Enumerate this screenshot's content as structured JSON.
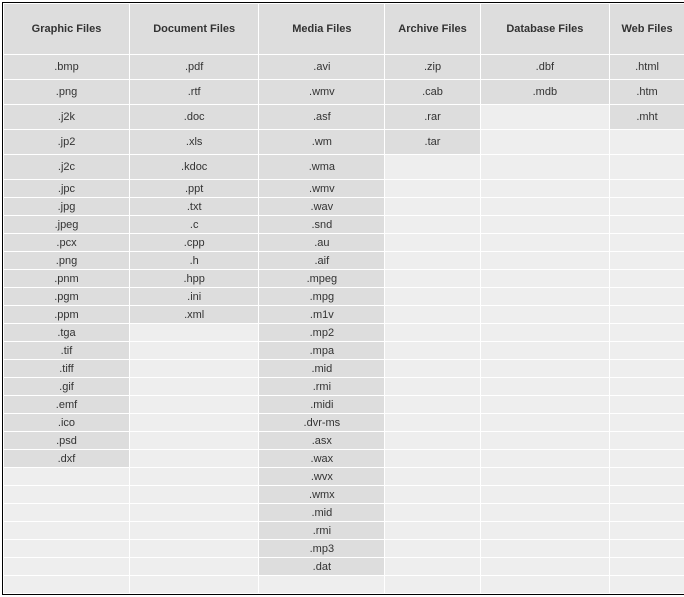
{
  "headers": [
    "Graphic Files",
    "Document Files",
    "Media Files",
    "Archive Files",
    "Database Files",
    "Web Files"
  ],
  "tallRows": 5,
  "columns": [
    [
      ".bmp",
      ".png",
      ".j2k",
      ".jp2",
      ".j2c",
      ".jpc",
      ".jpg",
      ".jpeg",
      ".pcx",
      ".png",
      ".pnm",
      ".pgm",
      ".ppm",
      ".tga",
      ".tif",
      ".tiff",
      ".gif",
      ".emf",
      ".ico",
      ".psd",
      ".dxf",
      "",
      "",
      "",
      "",
      "",
      "",
      ""
    ],
    [
      ".pdf",
      ".rtf",
      ".doc",
      ".xls",
      ".kdoc",
      ".ppt",
      ".txt",
      ".c",
      ".cpp",
      ".h",
      ".hpp",
      ".ini",
      ".xml",
      "",
      "",
      "",
      "",
      "",
      "",
      "",
      "",
      "",
      "",
      "",
      "",
      "",
      "",
      ""
    ],
    [
      ".avi",
      ".wmv",
      ".asf",
      ".wm",
      ".wma",
      ".wmv",
      ".wav",
      ".snd",
      ".au",
      ".aif",
      ".mpeg",
      ".mpg",
      ".m1v",
      ".mp2",
      ".mpa",
      ".mid",
      ".rmi",
      ".midi",
      ".dvr-ms",
      ".asx",
      ".wax",
      ".wvx",
      ".wmx",
      ".mid",
      ".rmi",
      ".mp3",
      ".dat",
      ""
    ],
    [
      ".zip",
      ".cab",
      ".rar",
      ".tar",
      "",
      "",
      "",
      "",
      "",
      "",
      "",
      "",
      "",
      "",
      "",
      "",
      "",
      "",
      "",
      "",
      "",
      "",
      "",
      "",
      "",
      "",
      "",
      ""
    ],
    [
      ".dbf",
      ".mdb",
      "",
      "",
      "",
      "",
      "",
      "",
      "",
      "",
      "",
      "",
      "",
      "",
      "",
      "",
      "",
      "",
      "",
      "",
      "",
      "",
      "",
      "",
      "",
      "",
      "",
      ""
    ],
    [
      ".html",
      ".htm",
      ".mht",
      "",
      "",
      "",
      "",
      "",
      "",
      "",
      "",
      "",
      "",
      "",
      "",
      "",
      "",
      "",
      "",
      "",
      "",
      "",
      "",
      "",
      "",
      "",
      "",
      ""
    ]
  ]
}
